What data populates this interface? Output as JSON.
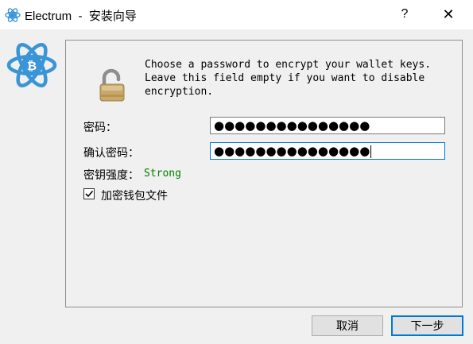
{
  "window": {
    "title": "Electrum  -  安装向导",
    "help_glyph": "?",
    "close_glyph": "✕"
  },
  "message": {
    "lines": [
      "Choose a password to encrypt your wallet keys.",
      "Leave this field empty if you want to disable",
      "encryption."
    ]
  },
  "form": {
    "password_label": "密码：",
    "password_value": "●●●●●●●●●●●●●●●",
    "confirm_label": "确认密码：",
    "confirm_value": "●●●●●●●●●●●●●●●",
    "strength_label": "密钥强度：",
    "strength_value": "Strong",
    "encrypt_checkbox_label": "加密钱包文件",
    "encrypt_checked": true
  },
  "buttons": {
    "cancel": "取消",
    "next": "下一步"
  },
  "colors": {
    "strength": "#008000",
    "accent": "#0078d7",
    "logo_blue": "#3a95d7",
    "lock_gold": "#c8a86a"
  },
  "icons": {
    "app": "electrum-logo-icon",
    "lock": "lock-icon",
    "check": "checkmark-icon"
  }
}
